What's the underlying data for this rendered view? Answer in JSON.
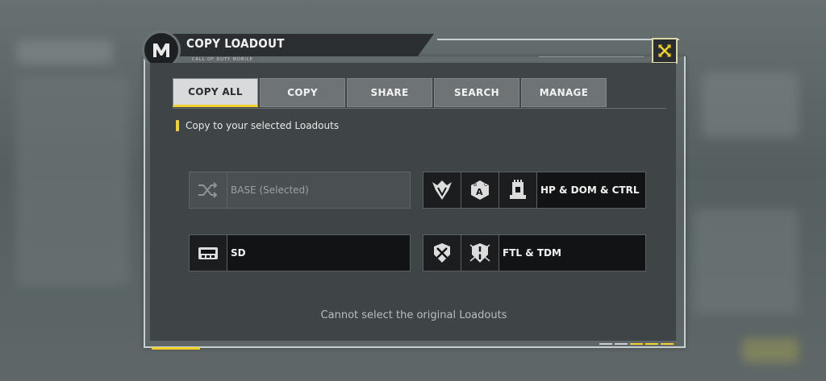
{
  "dialog": {
    "title": "COPY LOADOUT",
    "subtitle": "CALL OF DUTY MOBILE",
    "close_icon": "close-x-icon"
  },
  "tabs": [
    {
      "label": "COPY ALL",
      "active": true
    },
    {
      "label": "COPY",
      "active": false
    },
    {
      "label": "SHARE",
      "active": false
    },
    {
      "label": "SEARCH",
      "active": false
    },
    {
      "label": "MANAGE",
      "active": false
    }
  ],
  "section": {
    "label": "Copy to your selected Loadouts"
  },
  "loadouts": [
    {
      "label": "BASE (Selected)",
      "icons": [
        "shuffle-icon"
      ],
      "disabled": true
    },
    {
      "label": "HP & DOM & CTRL",
      "icons": [
        "hardpoint-mode-icon",
        "domination-mode-icon",
        "control-mode-icon"
      ],
      "disabled": false
    },
    {
      "label": "SD",
      "icons": [
        "search-and-destroy-mode-icon"
      ],
      "disabled": false
    },
    {
      "label": "FTL & TDM",
      "icons": [
        "frontline-mode-icon",
        "team-deathmatch-mode-icon"
      ],
      "disabled": false
    }
  ],
  "notice": "Cannot select the original Loadouts",
  "colors": {
    "accent": "#f2d12a",
    "panel": "#3f4447",
    "slot": "#121314"
  }
}
